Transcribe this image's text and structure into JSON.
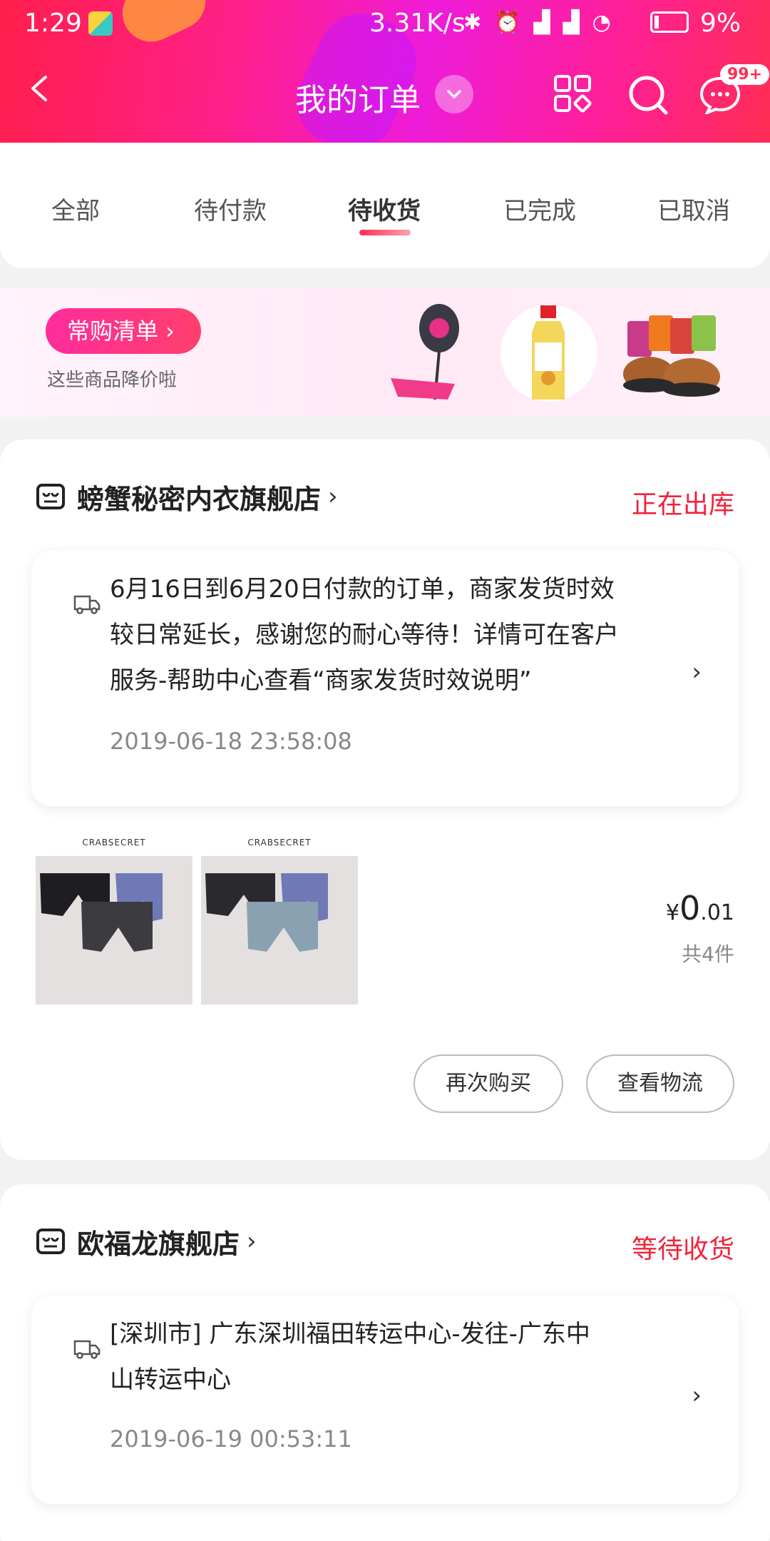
{
  "status_bar": {
    "time": "1:29",
    "speed": "3.31K/s",
    "battery": "9%"
  },
  "header": {
    "title": "我的订单",
    "badge": "99+"
  },
  "tabs": [
    {
      "label": "全部"
    },
    {
      "label": "待付款"
    },
    {
      "label": "待收货"
    },
    {
      "label": "已完成"
    },
    {
      "label": "已取消"
    }
  ],
  "promo": {
    "button": "常购清单 ›",
    "subtitle": "这些商品降价啦"
  },
  "orders": [
    {
      "store": "螃蟹秘密内衣旗舰店",
      "status": "正在出库",
      "message_lines": [
        "6月16日到6月20日付款的订单，商家发货时效",
        "较日常延长，感谢您的耐心等待！详情可在客户",
        "服务-帮助中心查看“商家发货时效说明”"
      ],
      "time": "2019-06-18 23:58:08",
      "product_brand": "CRABSECRET",
      "price_symbol": "¥",
      "price_int": "0",
      "price_dec": ".01",
      "quantity": "共4件",
      "buttons": {
        "rebuy": "再次购买",
        "logistics": "查看物流"
      }
    },
    {
      "store": "欧福龙旗舰店",
      "status": "等待收货",
      "message_lines": [
        "[深圳市] 广东深圳福田转运中心-发往-广东中",
        "山转运中心"
      ],
      "time": "2019-06-19 00:53:11"
    }
  ],
  "colors": {
    "accent": "#f0243c",
    "header_pink": "#ff1f88"
  }
}
